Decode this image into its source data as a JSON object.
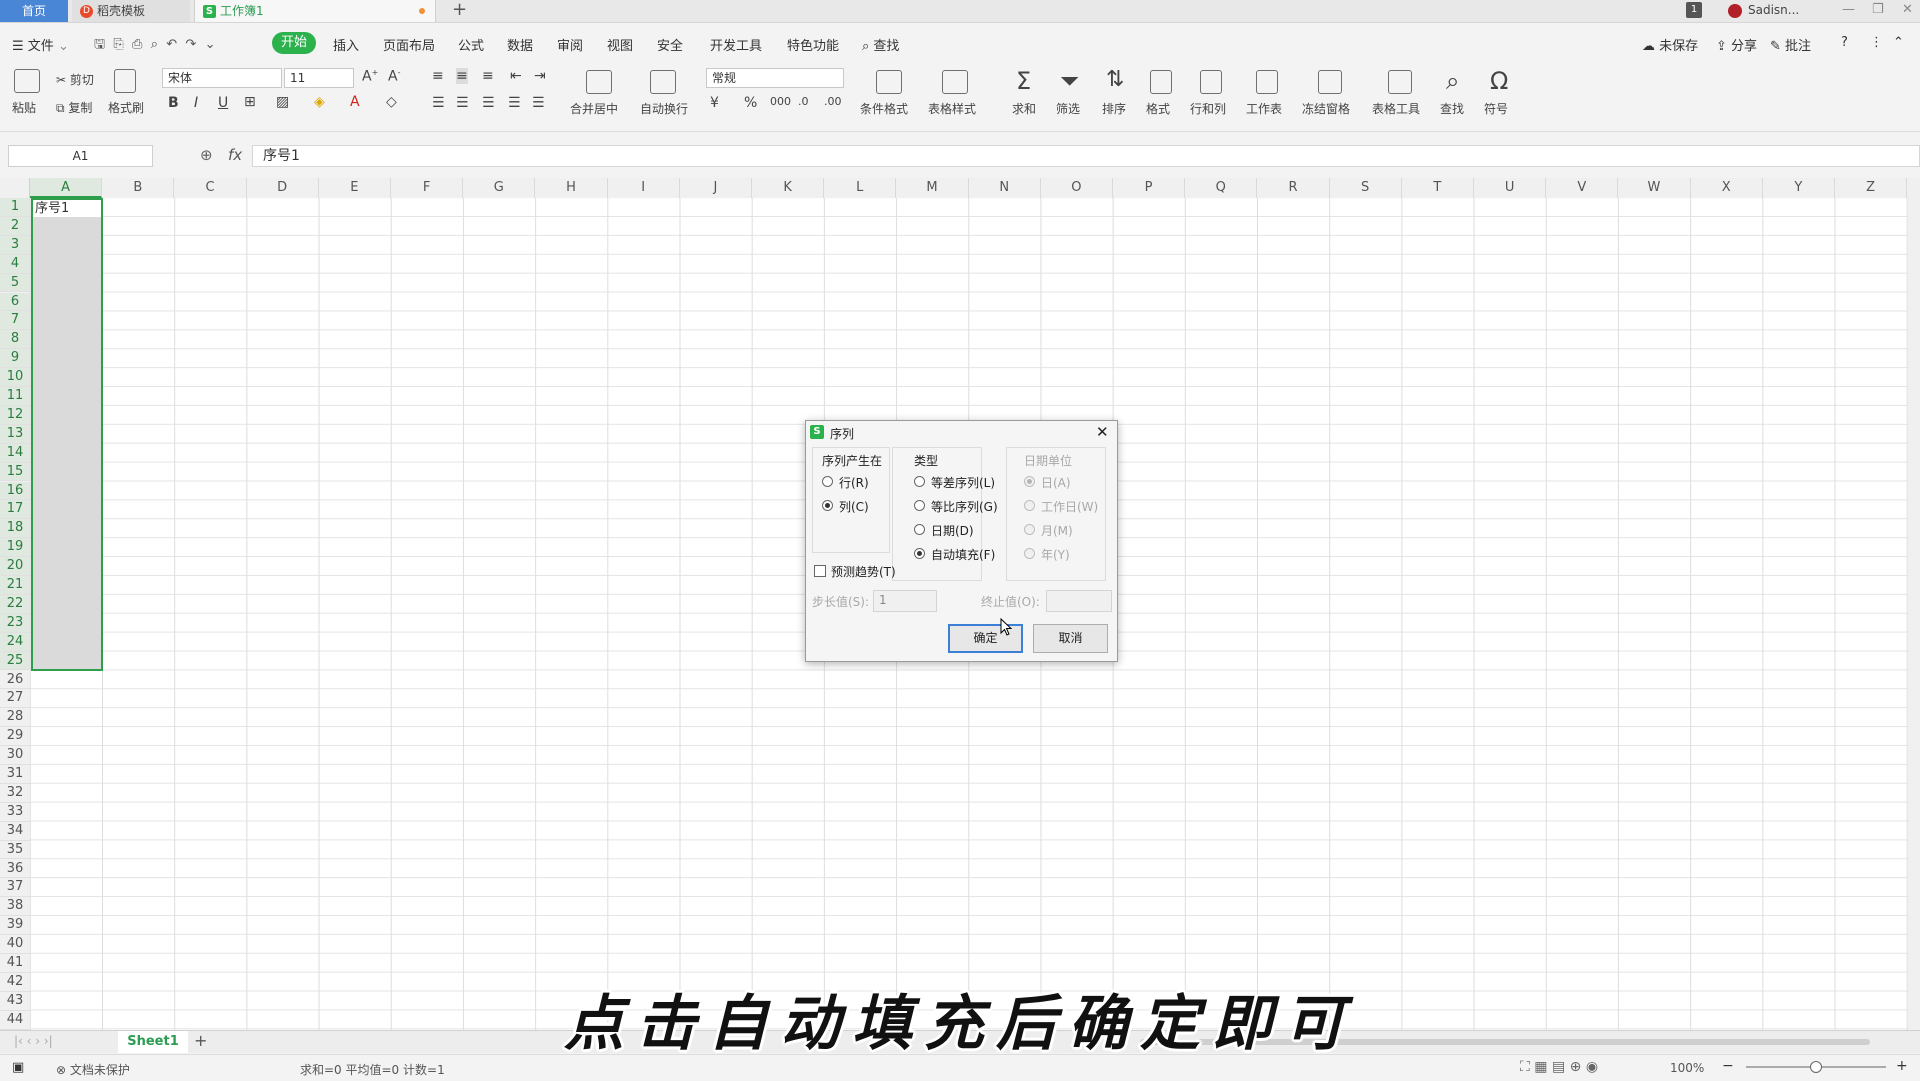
{
  "titlebar": {
    "tabs": [
      {
        "label": "首页"
      },
      {
        "label": "稻壳模板"
      },
      {
        "label": "工作簿1"
      }
    ],
    "plus": "+",
    "badge": "1",
    "user": "Sadisn..."
  },
  "menubar": {
    "file": "文件",
    "items": [
      "开始",
      "插入",
      "页面布局",
      "公式",
      "数据",
      "审阅",
      "视图",
      "安全",
      "开发工具",
      "特色功能"
    ],
    "search": "查找",
    "right": {
      "unsaved": "未保存",
      "share": "分享",
      "comment": "批注"
    }
  },
  "ribbon": {
    "paste": "粘贴",
    "cut": "剪切",
    "copy": "复制",
    "format_painter": "格式刷",
    "font_name": "宋体",
    "font_size": "11",
    "merge": "合并居中",
    "wrap": "自动换行",
    "number_format": "常规",
    "cond_format": "条件格式",
    "table_style": "表格样式",
    "sum": "求和",
    "filter": "筛选",
    "sort": "排序",
    "format": "格式",
    "rowcol": "行和列",
    "worksheet": "工作表",
    "freeze": "冻结窗格",
    "table_tools": "表格工具",
    "find": "查找",
    "symbol": "符号",
    "bold": "B",
    "italic": "I",
    "underline": "U"
  },
  "formula": {
    "name_box": "A1",
    "fx": "fx",
    "content": "序号1"
  },
  "grid": {
    "columns": [
      "A",
      "B",
      "C",
      "D",
      "E",
      "F",
      "G",
      "H",
      "I",
      "J",
      "K",
      "L",
      "M",
      "N",
      "O",
      "P",
      "Q",
      "R",
      "S",
      "T",
      "U",
      "V",
      "W",
      "X",
      "Y",
      "Z"
    ],
    "row_count": 44,
    "a1_value": "序号1"
  },
  "sheets": {
    "active": "Sheet1",
    "add": "+"
  },
  "status": {
    "protect": "文档未保护",
    "stats": "求和=0  平均值=0  计数=1",
    "zoom": "100%"
  },
  "dialog": {
    "title": "序列",
    "series_in": {
      "label": "序列产生在",
      "row": "行(R)",
      "col": "列(C)",
      "selected": "col"
    },
    "type": {
      "label": "类型",
      "linear": "等差序列(L)",
      "growth": "等比序列(G)",
      "date": "日期(D)",
      "autofill": "自动填充(F)",
      "selected": "autofill"
    },
    "date_unit": {
      "label": "日期单位",
      "day": "日(A)",
      "weekday": "工作日(W)",
      "month": "月(M)",
      "year": "年(Y)"
    },
    "trend": "预测趋势(T)",
    "step_label": "步长值(S):",
    "step_value": "1",
    "stop_label": "终止值(O):",
    "stop_value": "",
    "ok": "确定",
    "cancel": "取消"
  },
  "caption": "点击自动填充后确定即可"
}
